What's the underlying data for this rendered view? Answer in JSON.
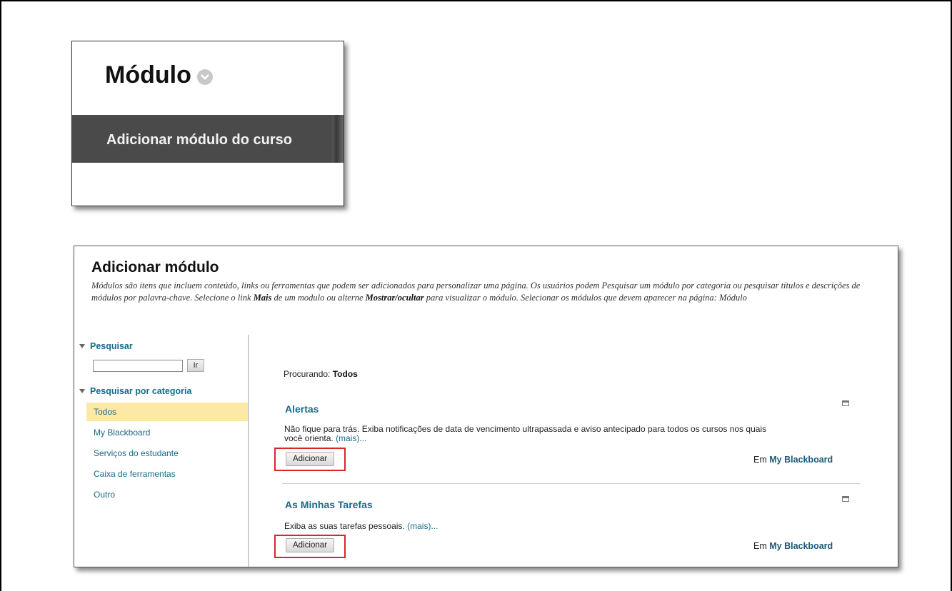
{
  "module_menu": {
    "title": "Módulo",
    "add_course_module": "Adicionar módulo do curso"
  },
  "add_module": {
    "title": "Adicionar módulo",
    "description_part1": "Módulos são itens que incluem conteúdo, links ou ferramentas que podem ser adicionados para personalizar uma página. Os usuários podem Pesquisar um módulo por categoria ou pesquisar títulos e descrições de módulos por palavra-chave. Selecione o link ",
    "description_more": "Mais",
    "description_part2": " de um modulo ou alterne ",
    "description_toggle": "Mostrar/ocultar",
    "description_part3": " para visualizar o módulo. Selecionar os módulos que devem aparecer na página: Módulo"
  },
  "sidebar": {
    "search_heading": "Pesquisar",
    "search_value": "",
    "go_label": "Ir",
    "category_heading": "Pesquisar por categoria",
    "categories": [
      {
        "label": "Todos",
        "selected": true
      },
      {
        "label": "My Blackboard",
        "selected": false
      },
      {
        "label": "Serviços do estudante",
        "selected": false
      },
      {
        "label": "Caixa de ferramentas",
        "selected": false
      },
      {
        "label": "Outro",
        "selected": false
      }
    ]
  },
  "results": {
    "searching_label": "Procurando:",
    "searching_value": "Todos",
    "modules": [
      {
        "title": "Alertas",
        "description": "Não fique para trás. Exiba notificações de data de vencimento ultrapassada e aviso antecipado para todos os cursos nos quais você orienta.",
        "more": "(mais)...",
        "add_label": "Adicionar",
        "in_label": "Em",
        "in_value": "My Blackboard"
      },
      {
        "title": "As Minhas Tarefas",
        "description": "Exiba as suas tarefas pessoais.",
        "more": "(mais)...",
        "add_label": "Adicionar",
        "in_label": "Em",
        "in_value": "My Blackboard"
      }
    ]
  },
  "colors": {
    "link": "#1a6a88",
    "highlight": "#fde9a6",
    "annotation_red": "#d9262c",
    "menu_bar": "#4a4a4a"
  }
}
